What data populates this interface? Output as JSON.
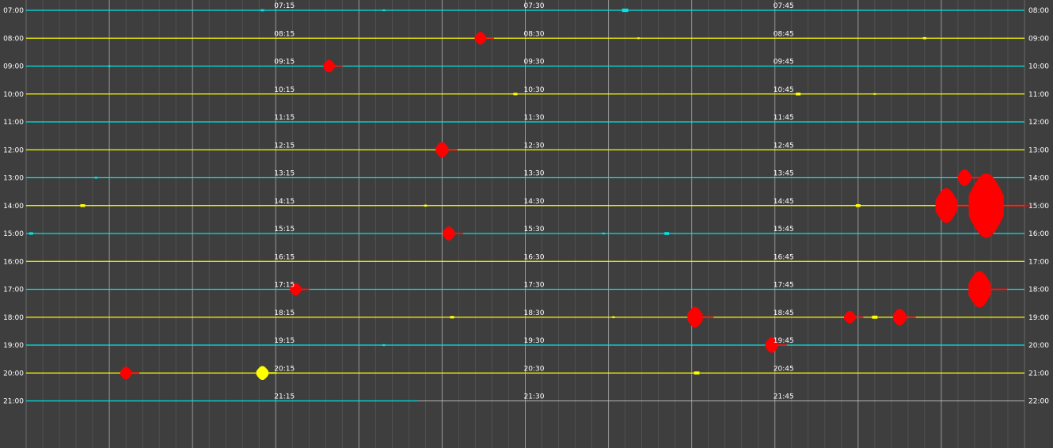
{
  "chart_data": {
    "type": "line",
    "title": "",
    "xlabel": "",
    "ylabel": "",
    "minutes_per_row": 60,
    "colors": {
      "background": "#3e3e3e",
      "grid_minor": "#6a6a6a",
      "grid_major": "#bdbdbd",
      "label": "#ffffff",
      "event": "#ff0000",
      "trace_a": "#00e5e5",
      "trace_b": "#ffff00"
    },
    "rows": [
      {
        "left_label": "07:00",
        "right_label": "08:00",
        "mid_labels": [
          "07:15",
          "07:30",
          "07:45"
        ],
        "color": "#00e5e5",
        "end_minute": 60
      },
      {
        "left_label": "08:00",
        "right_label": "09:00",
        "mid_labels": [
          "08:15",
          "08:30",
          "08:45"
        ],
        "color": "#ffff00",
        "end_minute": 60
      },
      {
        "left_label": "09:00",
        "right_label": "10:00",
        "mid_labels": [
          "09:15",
          "09:30",
          "09:45"
        ],
        "color": "#00e5e5",
        "end_minute": 60
      },
      {
        "left_label": "10:00",
        "right_label": "11:00",
        "mid_labels": [
          "10:15",
          "10:30",
          "10:45"
        ],
        "color": "#ffff00",
        "end_minute": 60
      },
      {
        "left_label": "11:00",
        "right_label": "12:00",
        "mid_labels": [
          "11:15",
          "11:30",
          "11:45"
        ],
        "color": "#00e5e5",
        "end_minute": 60
      },
      {
        "left_label": "12:00",
        "right_label": "13:00",
        "mid_labels": [
          "12:15",
          "12:30",
          "12:45"
        ],
        "color": "#ffff00",
        "end_minute": 60
      },
      {
        "left_label": "13:00",
        "right_label": "14:00",
        "mid_labels": [
          "13:15",
          "13:30",
          "13:45"
        ],
        "color": "#00e5e5",
        "end_minute": 60
      },
      {
        "left_label": "14:00",
        "right_label": "15:00",
        "mid_labels": [
          "14:15",
          "14:30",
          "14:45"
        ],
        "color": "#ffff00",
        "end_minute": 60
      },
      {
        "left_label": "15:00",
        "right_label": "16:00",
        "mid_labels": [
          "15:15",
          "15:30",
          "15:45"
        ],
        "color": "#00e5e5",
        "end_minute": 60
      },
      {
        "left_label": "16:00",
        "right_label": "17:00",
        "mid_labels": [
          "16:15",
          "16:30",
          "16:45"
        ],
        "color": "#ffff00",
        "end_minute": 60
      },
      {
        "left_label": "17:00",
        "right_label": "18:00",
        "mid_labels": [
          "17:15",
          "17:30",
          "17:45"
        ],
        "color": "#00e5e5",
        "end_minute": 60
      },
      {
        "left_label": "18:00",
        "right_label": "19:00",
        "mid_labels": [
          "18:15",
          "18:30",
          "18:45"
        ],
        "color": "#ffff00",
        "end_minute": 60
      },
      {
        "left_label": "19:00",
        "right_label": "20:00",
        "mid_labels": [
          "19:15",
          "19:30",
          "19:45"
        ],
        "color": "#00e5e5",
        "end_minute": 60
      },
      {
        "left_label": "20:00",
        "right_label": "21:00",
        "mid_labels": [
          "20:15",
          "20:30",
          "20:45"
        ],
        "color": "#ffff00",
        "end_minute": 60
      },
      {
        "left_label": "21:00",
        "right_label": "22:00",
        "mid_labels": [
          "21:15",
          "21:30",
          "21:45"
        ],
        "color": "#00e5e5",
        "end_minute": 23.5
      }
    ],
    "events": [
      {
        "row": 0,
        "minute": 14.2,
        "amplitude": 0.15,
        "color": "#00e5e5"
      },
      {
        "row": 0,
        "minute": 21.5,
        "amplitude": 0.1,
        "color": "#00e5e5"
      },
      {
        "row": 0,
        "minute": 36.0,
        "amplitude": 0.35,
        "color": "#00e5e5"
      },
      {
        "row": 1,
        "minute": 27.3,
        "amplitude": 0.45,
        "color": "#ff0000"
      },
      {
        "row": 1,
        "minute": 36.8,
        "amplitude": 0.08,
        "color": "#ffff00"
      },
      {
        "row": 1,
        "minute": 54.0,
        "amplitude": 0.15,
        "color": "#ffff00"
      },
      {
        "row": 2,
        "minute": 5.0,
        "amplitude": 0.08,
        "color": "#00e5e5"
      },
      {
        "row": 2,
        "minute": 18.2,
        "amplitude": 0.45,
        "color": "#ff0000"
      },
      {
        "row": 3,
        "minute": 29.4,
        "amplitude": 0.2,
        "color": "#ffff00"
      },
      {
        "row": 3,
        "minute": 46.4,
        "amplitude": 0.25,
        "color": "#ffff00"
      },
      {
        "row": 3,
        "minute": 51.0,
        "amplitude": 0.08,
        "color": "#ffff00"
      },
      {
        "row": 5,
        "minute": 25.0,
        "amplitude": 0.55,
        "color": "#ff0000"
      },
      {
        "row": 6,
        "minute": 4.2,
        "amplitude": 0.1,
        "color": "#00e5e5"
      },
      {
        "row": 6,
        "minute": 56.4,
        "amplitude": 0.6,
        "color": "#ff0000"
      },
      {
        "row": 7,
        "minute": 3.4,
        "amplitude": 0.25,
        "color": "#ffff00"
      },
      {
        "row": 7,
        "minute": 24.0,
        "amplitude": 0.12,
        "color": "#ffff00"
      },
      {
        "row": 7,
        "minute": 50.0,
        "amplitude": 0.25,
        "color": "#ffff00"
      },
      {
        "row": 7,
        "minute": 55.3,
        "amplitude": 1.25,
        "color": "#ff0000"
      },
      {
        "row": 7,
        "minute": 57.7,
        "amplitude": 2.3,
        "color": "#ff0000"
      },
      {
        "row": 8,
        "minute": 0.3,
        "amplitude": 0.2,
        "color": "#00e5e5"
      },
      {
        "row": 8,
        "minute": 25.4,
        "amplitude": 0.5,
        "color": "#ff0000"
      },
      {
        "row": 8,
        "minute": 34.7,
        "amplitude": 0.1,
        "color": "#00e5e5"
      },
      {
        "row": 8,
        "minute": 38.5,
        "amplitude": 0.25,
        "color": "#00e5e5"
      },
      {
        "row": 10,
        "minute": 16.2,
        "amplitude": 0.45,
        "color": "#ff0000"
      },
      {
        "row": 10,
        "minute": 57.3,
        "amplitude": 1.3,
        "color": "#ff0000"
      },
      {
        "row": 11,
        "minute": 25.6,
        "amplitude": 0.2,
        "color": "#ffff00"
      },
      {
        "row": 11,
        "minute": 35.3,
        "amplitude": 0.1,
        "color": "#ffff00"
      },
      {
        "row": 11,
        "minute": 40.2,
        "amplitude": 0.75,
        "color": "#ff0000"
      },
      {
        "row": 11,
        "minute": 49.5,
        "amplitude": 0.45,
        "color": "#ff0000"
      },
      {
        "row": 11,
        "minute": 51.0,
        "amplitude": 0.3,
        "color": "#ffff00"
      },
      {
        "row": 11,
        "minute": 52.5,
        "amplitude": 0.6,
        "color": "#ff0000"
      },
      {
        "row": 12,
        "minute": 21.5,
        "amplitude": 0.1,
        "color": "#00e5e5"
      },
      {
        "row": 12,
        "minute": 44.8,
        "amplitude": 0.55,
        "color": "#ff0000"
      },
      {
        "row": 13,
        "minute": 6.0,
        "amplitude": 0.45,
        "color": "#ff0000"
      },
      {
        "row": 13,
        "minute": 14.2,
        "amplitude": 0.5,
        "color": "#ffff00"
      },
      {
        "row": 13,
        "minute": 40.3,
        "amplitude": 0.3,
        "color": "#ffff00"
      }
    ]
  }
}
